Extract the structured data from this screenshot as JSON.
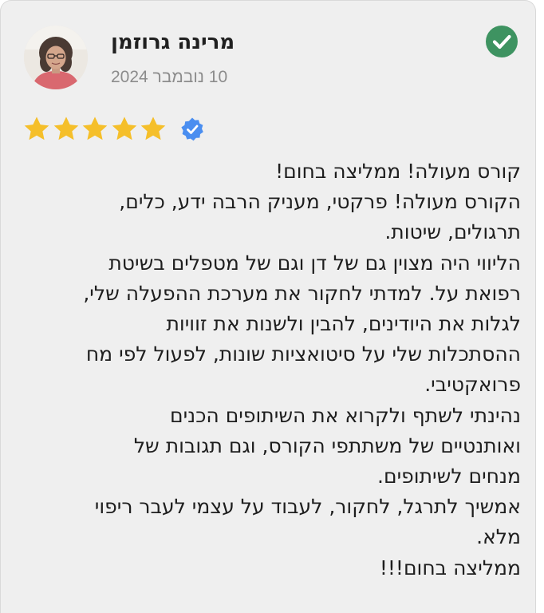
{
  "review": {
    "author": "מרינה גרוזמן",
    "date": "10 נובמבר 2024",
    "rating": 5,
    "max_rating": 5,
    "star_color": "#f5bf2a",
    "verified_badge_color": "#4a8ef0",
    "check_color": "#3e9361",
    "lines": [
      "קורס מעולה! ממליצה בחום!",
      "הקורס מעולה! פרקטי, מעניק הרבה ידע, כלים,",
      "תרגולים, שיטות.",
      "הליווי היה מצוין גם של דן וגם של מטפלים בשיטת",
      "רפואת על. למדתי לחקור את מערכת ההפעלה שלי,",
      "לגלות את היודינים, להבין ולשנות את זוויות",
      "ההסתכלות שלי על סיטואציות שונות, לפעול לפי מח",
      "פרואקטיבי.",
      "נהינתי לשתף ולקרוא את השיתופים הכנים",
      "ואותנטיים של משתתפי הקורס, וגם תגובות של",
      "מנחים לשיתופים.",
      "אמשיך לתרגל, לחקור, לעבוד על עצמי לעבר ריפוי",
      "מלא.",
      "ממליצה בחום!!!"
    ]
  }
}
